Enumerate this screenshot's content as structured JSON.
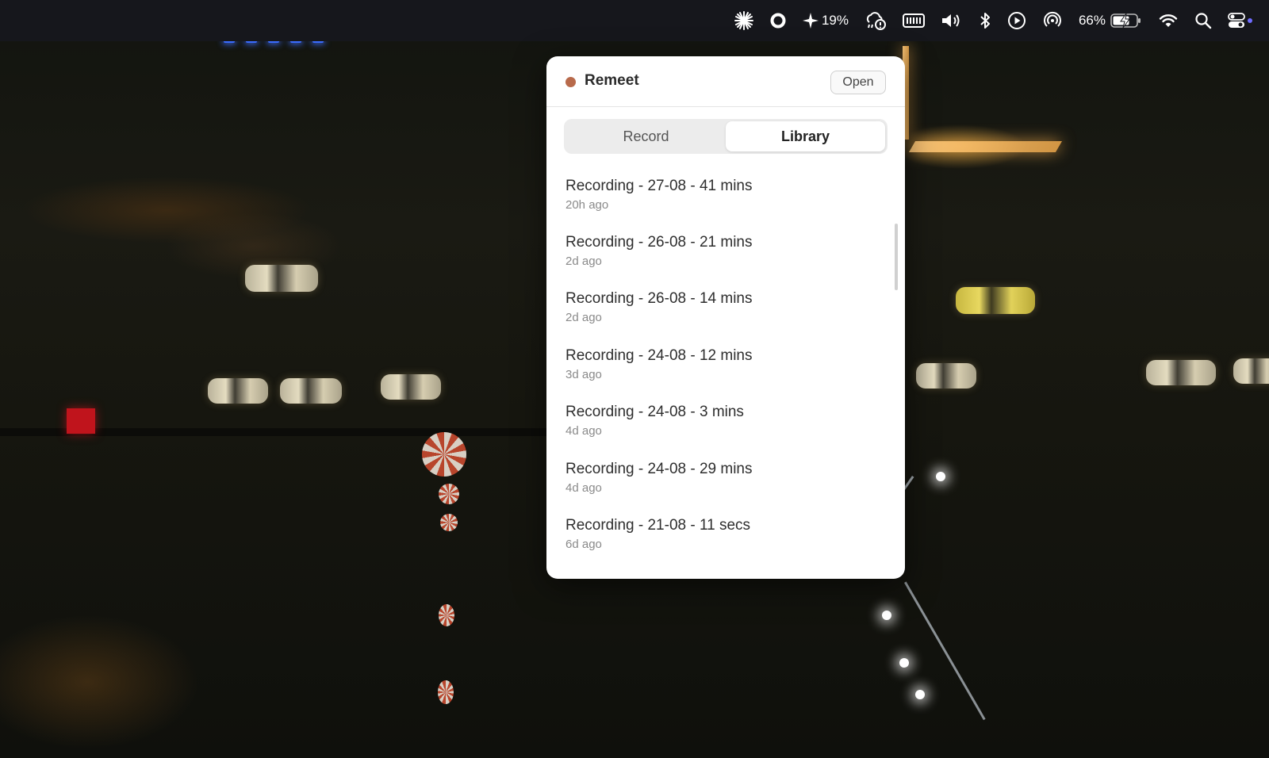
{
  "menubar": {
    "items": [
      {
        "icon": "asterisk-burst-icon"
      },
      {
        "icon": "record-circle-icon"
      },
      {
        "icon": "sparkle-icon",
        "label": "19%"
      },
      {
        "icon": "cloud-rain-alert-icon"
      },
      {
        "icon": "memory-chip-icon"
      },
      {
        "icon": "volume-icon"
      },
      {
        "icon": "bluetooth-icon"
      },
      {
        "icon": "play-circle-icon"
      },
      {
        "icon": "airdrop-icon"
      },
      {
        "icon": "battery-charging-icon",
        "label": "66%"
      },
      {
        "icon": "wifi-icon"
      },
      {
        "icon": "spotlight-search-icon"
      },
      {
        "icon": "control-center-icon"
      }
    ]
  },
  "panel": {
    "app_name": "Remeet",
    "status_color": "#b86a4b",
    "open_label": "Open",
    "tabs": [
      {
        "label": "Record",
        "active": false
      },
      {
        "label": "Library",
        "active": true
      }
    ],
    "recordings": [
      {
        "title": "Recording - 27-08 - 41 mins",
        "ago": "20h ago"
      },
      {
        "title": "Recording - 26-08 - 21 mins",
        "ago": "2d ago"
      },
      {
        "title": "Recording - 26-08 - 14 mins",
        "ago": "2d ago"
      },
      {
        "title": "Recording - 24-08 - 12 mins",
        "ago": "3d ago"
      },
      {
        "title": "Recording - 24-08 - 3 mins",
        "ago": "4d ago"
      },
      {
        "title": "Recording - 24-08 - 29 mins",
        "ago": "4d ago"
      },
      {
        "title": "Recording - 21-08 - 11 secs",
        "ago": "6d ago"
      }
    ]
  }
}
